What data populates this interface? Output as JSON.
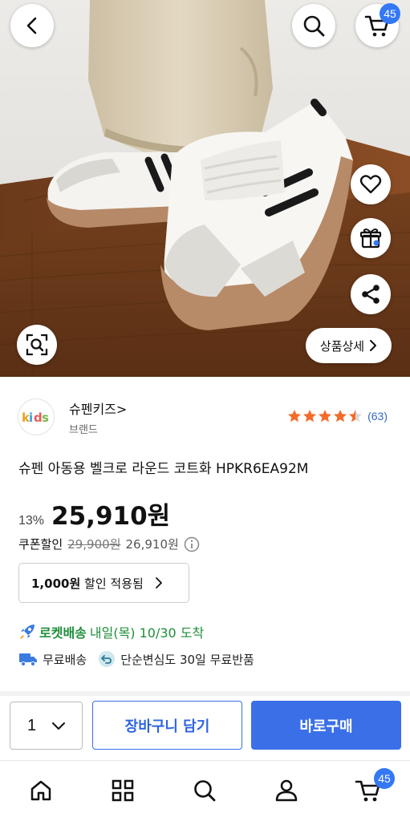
{
  "header": {
    "back_icon": "chevron-left-icon",
    "search_icon": "search-icon",
    "cart_icon": "cart-icon",
    "cart_count": "45"
  },
  "hero": {
    "wishlist_icon": "heart-icon",
    "gift_icon": "gift-icon",
    "share_icon": "share-icon",
    "zoom_icon": "image-search-icon",
    "detail_button_label": "상품상세"
  },
  "brand": {
    "logo_text": "kids",
    "name": "슈펜키즈>",
    "sub": "브랜드",
    "rating_value": 4.5,
    "rating_count": "(63)",
    "star_color": "#f46b2a"
  },
  "product": {
    "title": "슈펜 아동용 벨크로 라운드 코트화 HPKR6EA92M",
    "discount_rate": "13%",
    "price": "25,910원",
    "coupon_label": "쿠폰할인",
    "original_price": "29,900원",
    "coupon_price": "26,910원",
    "coupon_applied_amount": "1,000원",
    "coupon_applied_text": "할인 적용됨"
  },
  "shipping": {
    "rocket_label": "로켓배송",
    "arrival_text": "내일(목) 10/30 도착",
    "free_shipping": "무료배송",
    "return_text": "단순변심도 30일 무료반품"
  },
  "purchase": {
    "quantity": "1",
    "cart_button": "장바구니 담기",
    "buy_button": "바로구매",
    "accent_color": "#3a6fe8"
  },
  "tabbar": {
    "items": [
      "home-icon",
      "category-icon",
      "search-icon",
      "my-page-icon",
      "cart-icon"
    ],
    "cart_count": "45"
  }
}
